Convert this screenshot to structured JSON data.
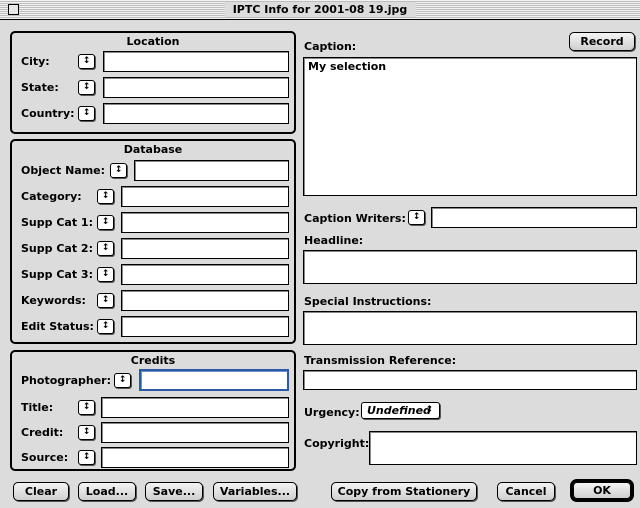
{
  "window": {
    "title": "IPTC Info for 2001-08 19.jpg"
  },
  "popup_glyph": "↕",
  "location": {
    "title": "Location",
    "fields": [
      {
        "label": "City:",
        "value": ""
      },
      {
        "label": "State:",
        "value": ""
      },
      {
        "label": "Country:",
        "value": ""
      }
    ]
  },
  "database": {
    "title": "Database",
    "fields": [
      {
        "label": "Object Name:",
        "value": ""
      },
      {
        "label": "Category:",
        "value": ""
      },
      {
        "label": "Supp Cat 1:",
        "value": ""
      },
      {
        "label": "Supp Cat 2:",
        "value": ""
      },
      {
        "label": "Supp Cat 3:",
        "value": ""
      },
      {
        "label": "Keywords:",
        "value": ""
      },
      {
        "label": "Edit Status:",
        "value": ""
      }
    ]
  },
  "credits": {
    "title": "Credits",
    "fields": [
      {
        "label": "Photographer:",
        "value": ""
      },
      {
        "label": "Title:",
        "value": ""
      },
      {
        "label": "Credit:",
        "value": ""
      },
      {
        "label": "Source:",
        "value": ""
      }
    ]
  },
  "right": {
    "caption_label": "Caption:",
    "record_button": "Record",
    "caption_value": "My selection",
    "caption_writers_label": "Caption Writers:",
    "caption_writers_value": "",
    "headline_label": "Headline:",
    "headline_value": "",
    "special_instructions_label": "Special Instructions:",
    "special_instructions_value": "",
    "transmission_reference_label": "Transmission Reference:",
    "transmission_reference_value": "",
    "urgency_label": "Urgency:",
    "urgency_value": "Undefined",
    "copyright_label": "Copyright:",
    "copyright_value": ""
  },
  "buttons": {
    "clear": "Clear",
    "load": "Load...",
    "save": "Save...",
    "variables": "Variables...",
    "copy_from_stationery": "Copy from Stationery",
    "cancel": "Cancel",
    "ok": "OK"
  }
}
